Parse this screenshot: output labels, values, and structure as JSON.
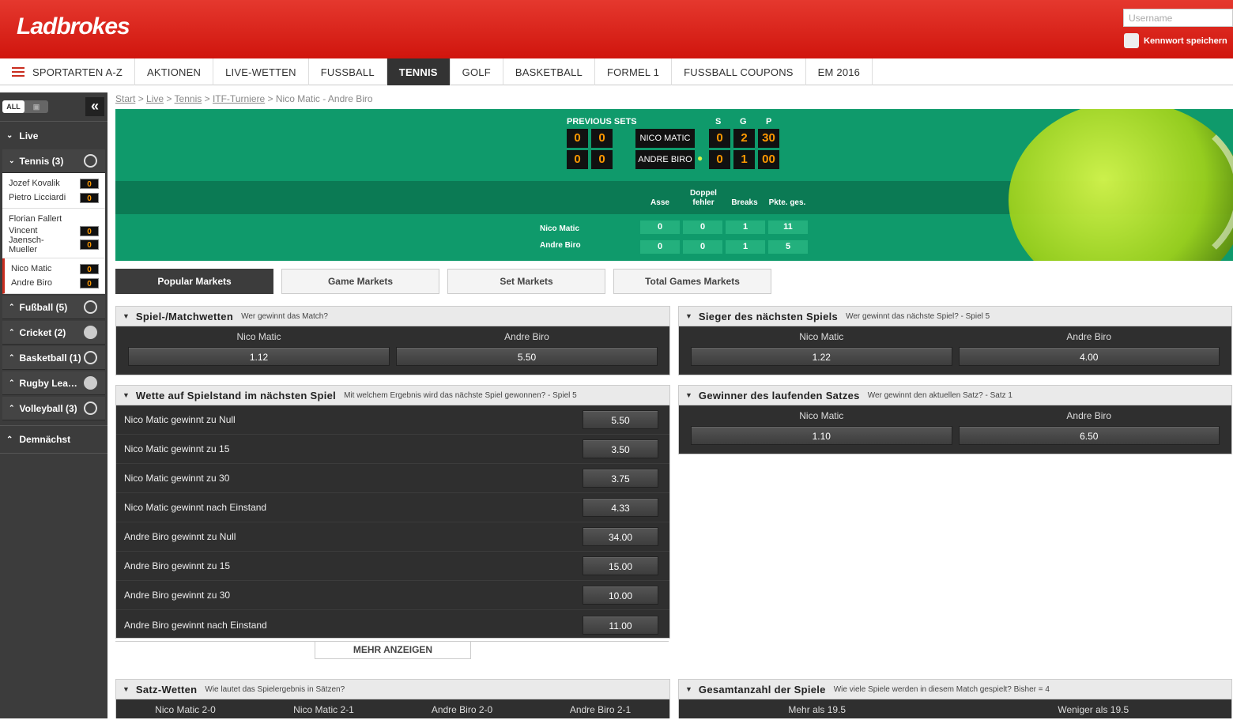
{
  "header": {
    "logo": "Ladbrokes",
    "username_placeholder": "Username",
    "remember_label": "Kennwort speichern"
  },
  "nav": {
    "items": [
      "SPORTARTEN A-Z",
      "AKTIONEN",
      "LIVE-WETTEN",
      "FUSSBALL",
      "TENNIS",
      "GOLF",
      "BASKETBALL",
      "FORMEL 1",
      "FUSSBALL COUPONS",
      "EM 2016"
    ],
    "active": "TENNIS"
  },
  "sidebar": {
    "toggle_on": "ALL",
    "live_label": "Live",
    "tennis_label": "Tennis (3)",
    "matches": [
      {
        "p1": "Jozef Kovalik",
        "p2": "Pietro Licciardi",
        "s1": "0",
        "s2": "0"
      },
      {
        "p1": "Florian Fallert",
        "p2": "Vincent Jaensch-Mueller",
        "s1": "0",
        "s2": "0"
      },
      {
        "p1": "Nico Matic",
        "p2": "Andre Biro",
        "s1": "0",
        "s2": "0"
      }
    ],
    "sports": [
      {
        "label": "Fußball (5)",
        "icon": "football-icon"
      },
      {
        "label": "Cricket (2)",
        "icon": "cricket-icon"
      },
      {
        "label": "Basketball (1)",
        "icon": "basketball-icon"
      },
      {
        "label": "Rugby Lea…",
        "icon": "rugby-icon"
      },
      {
        "label": "Volleyball (3)",
        "icon": "volleyball-icon"
      }
    ],
    "upcoming_label": "Demnächst"
  },
  "breadcrumb": {
    "items": [
      "Start",
      "Live",
      "Tennis",
      "ITF-Turniere"
    ],
    "sep": ">",
    "current": "Nico Matic - Andre Biro"
  },
  "scoreboard": {
    "previous_sets": "PREVIOUS SETS",
    "col_s": "S",
    "col_g": "G",
    "col_p": "P",
    "players": [
      {
        "name": "NICO MATIC",
        "prev1": "0",
        "prev2": "0",
        "s": "0",
        "g": "2",
        "p": "30"
      },
      {
        "name": "ANDRE BIRO",
        "prev1": "0",
        "prev2": "0",
        "s": "0",
        "g": "1",
        "p": "00"
      }
    ],
    "stat_heads": [
      "Asse",
      "Doppel fehler",
      "Breaks",
      "Pkte. ges."
    ],
    "stats": [
      {
        "name": "Nico Matic",
        "values": [
          "0",
          "0",
          "1",
          "11"
        ]
      },
      {
        "name": "Andre Biro",
        "values": [
          "0",
          "0",
          "1",
          "5"
        ]
      }
    ]
  },
  "tabs": [
    "Popular Markets",
    "Game Markets",
    "Set Markets",
    "Total Games Markets"
  ],
  "markets": {
    "match": {
      "title": "Spiel-/Matchwetten",
      "sub": "Wer gewinnt das Match?",
      "labels": [
        "Nico Matic",
        "Andre Biro"
      ],
      "odds": [
        "1.12",
        "5.50"
      ]
    },
    "next_game": {
      "title": "Sieger des nächsten Spiels",
      "sub": "Wer gewinnt das nächste Spiel? - Spiel 5",
      "labels": [
        "Nico Matic",
        "Andre Biro"
      ],
      "odds": [
        "1.22",
        "4.00"
      ]
    },
    "score_next": {
      "title": "Wette auf Spielstand im nächsten Spiel",
      "sub": "Mit welchem Ergebnis wird das nächste Spiel gewonnen? - Spiel 5",
      "rows": [
        {
          "label": "Nico Matic gewinnt zu Null",
          "odd": "5.50"
        },
        {
          "label": "Nico Matic gewinnt zu 15",
          "odd": "3.50"
        },
        {
          "label": "Nico Matic gewinnt zu 30",
          "odd": "3.75"
        },
        {
          "label": "Nico Matic gewinnt nach Einstand",
          "odd": "4.33"
        },
        {
          "label": "Andre Biro gewinnt zu Null",
          "odd": "34.00"
        },
        {
          "label": "Andre Biro gewinnt zu 15",
          "odd": "15.00"
        },
        {
          "label": "Andre Biro gewinnt zu 30",
          "odd": "10.00"
        },
        {
          "label": "Andre Biro gewinnt nach Einstand",
          "odd": "11.00"
        }
      ],
      "more": "MEHR ANZEIGEN"
    },
    "current_set": {
      "title": "Gewinner des laufenden Satzes",
      "sub": "Wer gewinnt den aktuellen Satz? - Satz 1",
      "labels": [
        "Nico Matic",
        "Andre Biro"
      ],
      "odds": [
        "1.10",
        "6.50"
      ]
    },
    "set_bets": {
      "title": "Satz-Wetten",
      "sub": "Wie lautet das Spielergebnis in Sätzen?",
      "labels": [
        "Nico Matic 2-0",
        "Nico Matic 2-1",
        "Andre Biro 2-0",
        "Andre Biro 2-1"
      ]
    },
    "total_games": {
      "title": "Gesamtanzahl der Spiele",
      "sub": "Wie viele Spiele werden in diesem Match gespielt? Bisher = 4",
      "labels": [
        "Mehr als 19.5",
        "Weniger als 19.5"
      ]
    }
  }
}
